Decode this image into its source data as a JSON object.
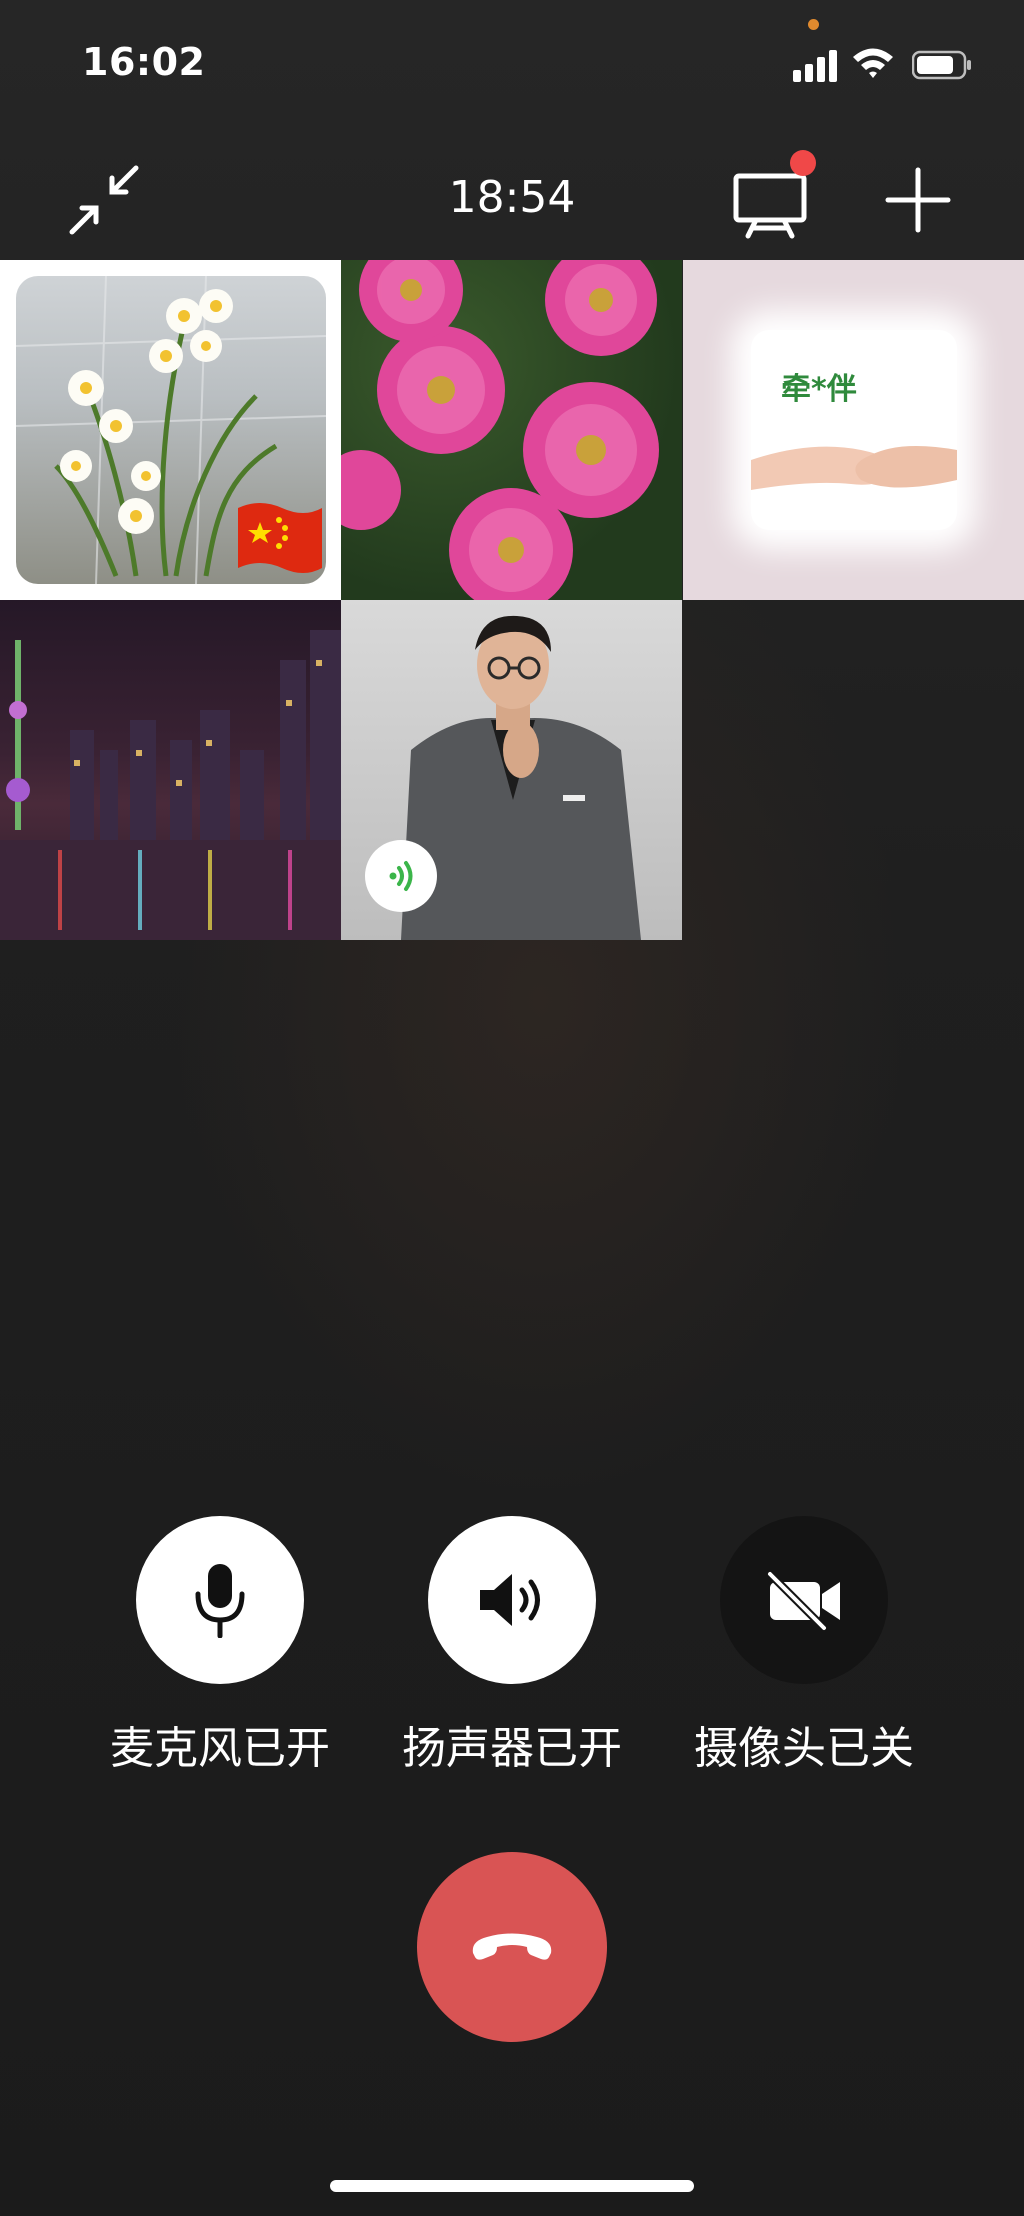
{
  "status_bar": {
    "time": "16:02"
  },
  "call": {
    "duration": "18:54"
  },
  "controls": [
    {
      "label": "麦克风已开",
      "state": "on",
      "icon": "microphone-icon"
    },
    {
      "label": "扬声器已开",
      "state": "on",
      "icon": "speaker-icon"
    },
    {
      "label": "摄像头已关",
      "state": "off",
      "icon": "camera-off-icon"
    }
  ],
  "participants": [
    {
      "avatar": "daffodils-with-flag"
    },
    {
      "avatar": "pink-daisies"
    },
    {
      "avatar": "holding-hands",
      "text": "牵*伴"
    },
    {
      "avatar": "city-skyline-night"
    },
    {
      "avatar": "man-in-suit",
      "speaking": true
    }
  ],
  "colors": {
    "hangup": "#d95454",
    "speaking": "#3bb54a",
    "notification": "#f04848"
  }
}
